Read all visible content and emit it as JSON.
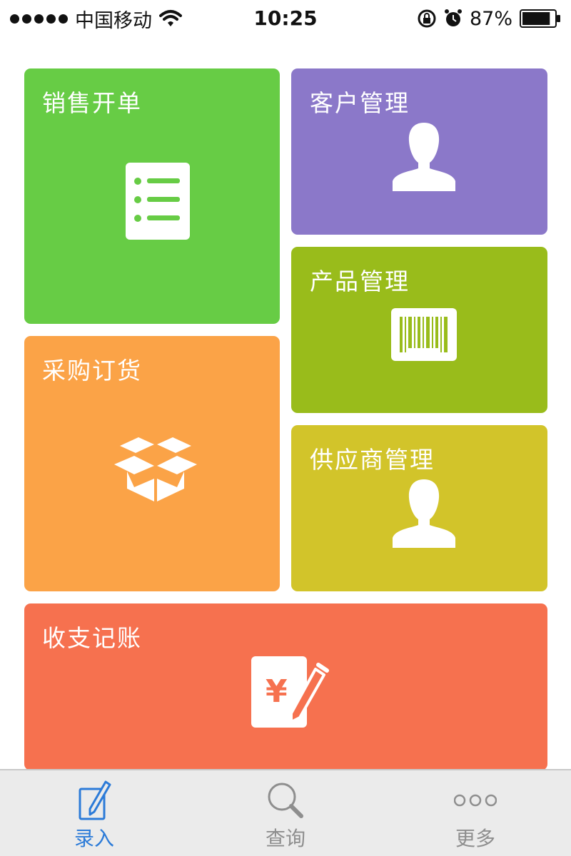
{
  "status_bar": {
    "carrier": "中国移动",
    "time": "10:25",
    "battery_percent": "87%",
    "battery_level": 0.87,
    "icons": [
      "signal-dots-icon",
      "wifi-icon",
      "rotation-lock-icon",
      "alarm-icon",
      "battery-icon"
    ]
  },
  "tiles": {
    "sales": {
      "label": "销售开单",
      "icon": "list-document-icon",
      "color": "#67cc45"
    },
    "customer": {
      "label": "客户管理",
      "icon": "person-icon",
      "color": "#8b78c9"
    },
    "product": {
      "label": "产品管理",
      "icon": "barcode-icon",
      "color": "#99bc1b"
    },
    "purchase": {
      "label": "采购订货",
      "icon": "open-box-icon",
      "color": "#fba347"
    },
    "supplier": {
      "label": "供应商管理",
      "icon": "person-icon",
      "color": "#d2c42a"
    },
    "ledger": {
      "label": "收支记账",
      "icon": "yen-note-pen-icon",
      "color": "#f6714f"
    }
  },
  "tab_bar": {
    "tabs": [
      {
        "label": "录入",
        "icon": "edit-pen-icon",
        "active": true
      },
      {
        "label": "查询",
        "icon": "search-icon",
        "active": false
      },
      {
        "label": "更多",
        "icon": "more-dots-icon",
        "active": false
      }
    ],
    "active_color": "#2c7bd8",
    "inactive_color": "#8e8e8e"
  }
}
